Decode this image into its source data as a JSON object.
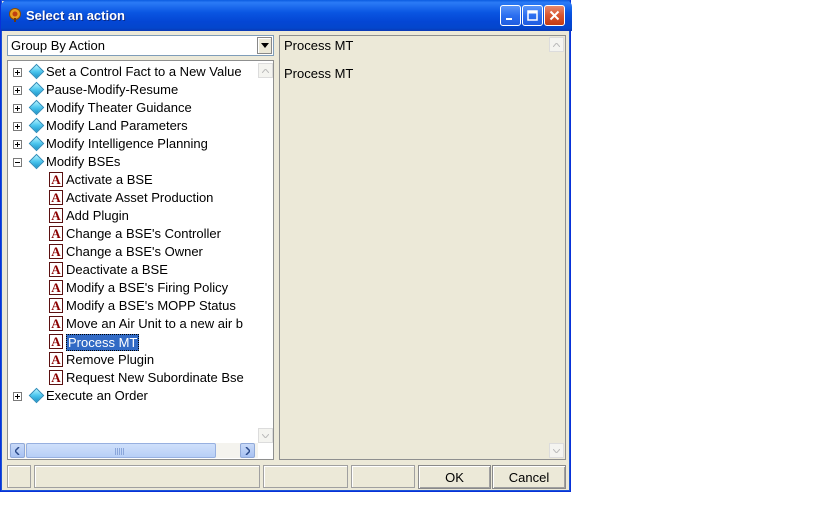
{
  "window": {
    "title": "Select an action"
  },
  "combo": {
    "value": "Group By Action"
  },
  "tree": {
    "groups_top": [
      {
        "label": "Set a Control Fact to a New Value",
        "expanded": false
      },
      {
        "label": "Pause-Modify-Resume",
        "expanded": false
      },
      {
        "label": "Modify Theater Guidance",
        "expanded": false
      },
      {
        "label": "Modify Land Parameters",
        "expanded": false
      },
      {
        "label": "Modify Intelligence Planning",
        "expanded": false
      },
      {
        "label": "Modify BSEs",
        "expanded": true
      }
    ],
    "actions": [
      "Activate a BSE",
      "Activate Asset Production",
      "Add Plugin",
      "Change a BSE's Controller",
      "Change a BSE's Owner",
      "Deactivate a BSE",
      "Modify a BSE's Firing Policy",
      "Modify a BSE's MOPP Status",
      "Move an Air Unit to a new air b",
      "Process MT",
      "Remove Plugin",
      "Request New Subordinate Bse"
    ],
    "selected_action": "Process MT",
    "groups_bottom": [
      {
        "label": "Execute an Order",
        "expanded": false
      }
    ]
  },
  "details": {
    "title": "Process MT",
    "description": "Process MT"
  },
  "buttons": {
    "ok": "OK",
    "cancel": "Cancel"
  },
  "colors": {
    "selection": "#316ac5",
    "titlebar": "#0a56e2",
    "dialog_bg": "#ece9d8"
  }
}
